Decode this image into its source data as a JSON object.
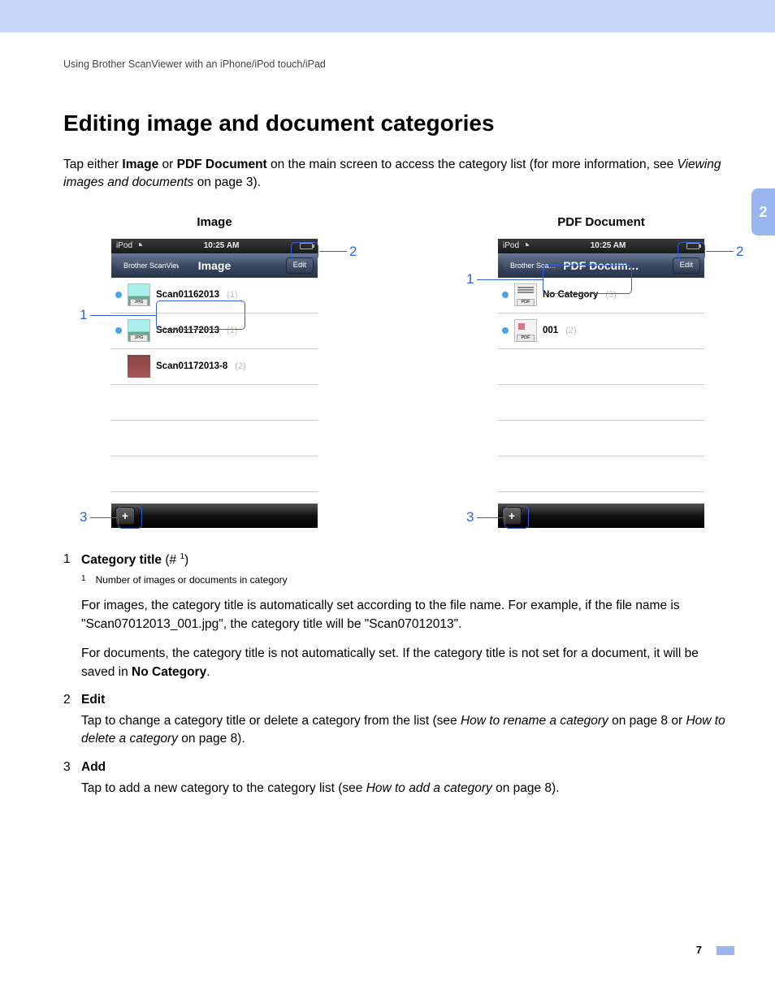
{
  "breadcrumb": "Using Brother ScanViewer with an iPhone/iPod touch/iPad",
  "chapterTab": "2",
  "heading": "Editing image and document categories",
  "intro": {
    "pre": "Tap either ",
    "b1": "Image",
    "mid1": " or ",
    "b2": "PDF Document",
    "mid2": " on the main screen to access the category list (for more information, see ",
    "i1": "Viewing images and documents",
    "post": " on page 3)."
  },
  "shot1": {
    "title": "Image",
    "device": "iPod",
    "time": "10:25 AM",
    "back": "Brother ScanViewer",
    "navTitle": "Image",
    "edit": "Edit",
    "rows": [
      {
        "dot": true,
        "thumbType": "jpg",
        "badge": "JPG",
        "label": "Scan01162013",
        "count": "(1)"
      },
      {
        "dot": true,
        "thumbType": "jpg",
        "badge": "JPG",
        "label": "Scan01172013",
        "count": "(1)"
      },
      {
        "dot": false,
        "thumbType": "photo",
        "badge": "",
        "label": "Scan01172013-8",
        "count": "(2)"
      }
    ],
    "add": "+",
    "c1": "1",
    "c2": "2",
    "c3": "3"
  },
  "shot2": {
    "title": "PDF Document",
    "device": "iPod",
    "time": "10:25 AM",
    "back": "Brother Sca…",
    "navTitle": "PDF Docum…",
    "edit": "Edit",
    "rows": [
      {
        "dot": true,
        "thumbType": "pdf",
        "badge": "PDF",
        "label": "No Category",
        "count": "(3)"
      },
      {
        "dot": true,
        "thumbType": "pdf2",
        "badge": "PDF",
        "label": "001",
        "count": "(2)"
      }
    ],
    "add": "+",
    "c1": "1",
    "c2": "2",
    "c3": "3"
  },
  "legend": {
    "item1": {
      "num": "1",
      "title": "Category title",
      "hash": " (# ",
      "sup": "1",
      "close": ")"
    },
    "fn": {
      "num": "1",
      "text": "Number of images or documents in category"
    },
    "p1a": "For images, the category title is automatically set according to the file name. For example, if the file name is \"Scan07012013_001.jpg\", the category title will be \"Scan07012013\".",
    "p1b_pre": "For documents, the category title is not automatically set. If the category title is not set for a document, it will be saved in ",
    "p1b_b": "No Category",
    "p1b_post": ".",
    "item2": {
      "num": "2",
      "title": "Edit"
    },
    "p2_pre": "Tap to change a category title or delete a category from the list (see ",
    "p2_i1": "How to rename a category",
    "p2_mid": " on page 8 or ",
    "p2_i2": "How to delete a category",
    "p2_post": " on page 8).",
    "item3": {
      "num": "3",
      "title": "Add"
    },
    "p3_pre": "Tap to add a new category to the category list (see ",
    "p3_i": "How to add a category",
    "p3_post": " on page 8)."
  },
  "pageNumber": "7"
}
